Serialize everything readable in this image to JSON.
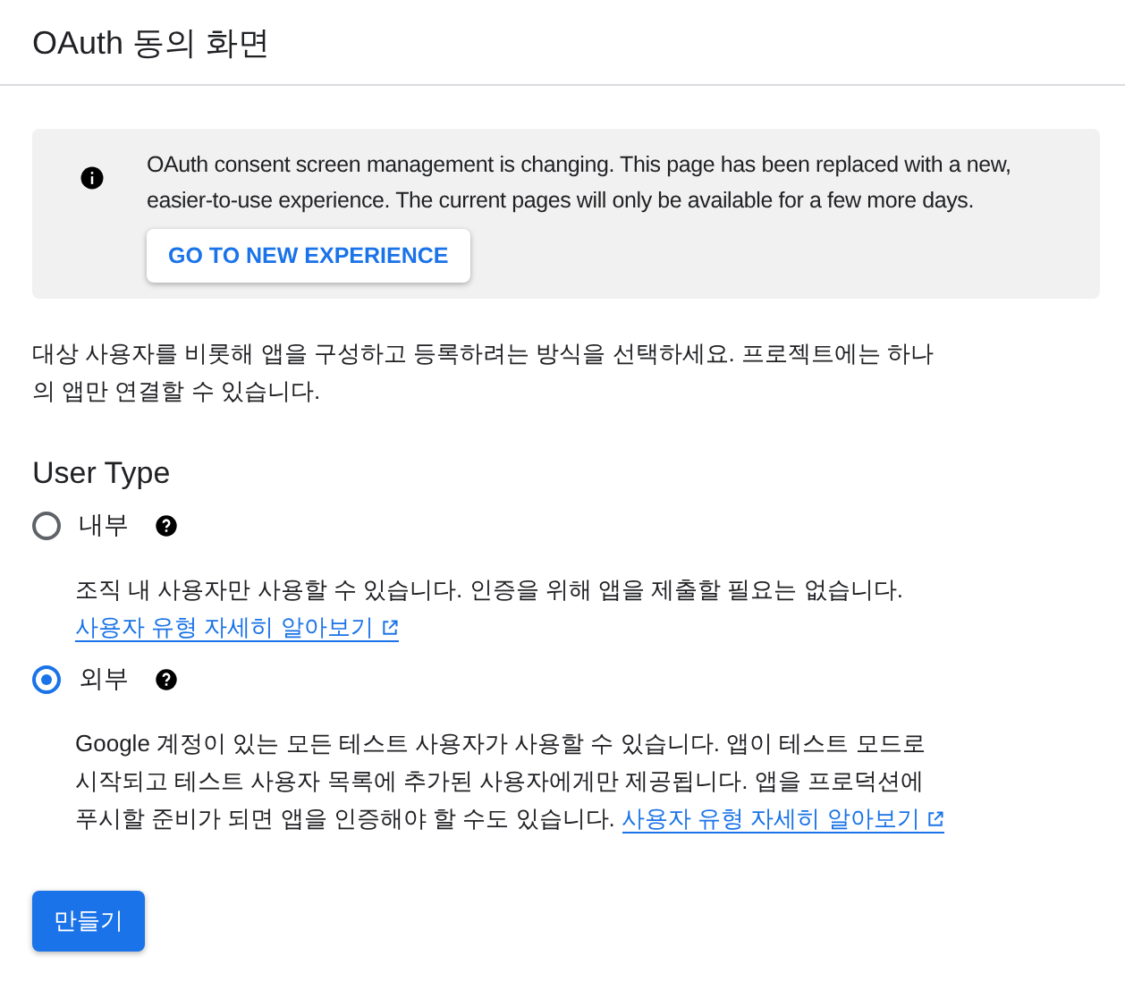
{
  "header": {
    "title": "OAuth 동의 화면"
  },
  "notice": {
    "text": "OAuth consent screen management is changing. This page has been replaced with a new, easier-to-use experience. The current pages will only be available for a few more days.",
    "button": "GO TO NEW EXPERIENCE"
  },
  "intro": "대상 사용자를 비롯해 앱을 구성하고 등록하려는 방식을 선택하세요. 프로젝트에는 하나의 앱만 연결할 수 있습니다.",
  "user_type": {
    "heading": "User Type",
    "options": [
      {
        "label": "내부",
        "selected": false,
        "description": "조직 내 사용자만 사용할 수 있습니다. 인증을 위해 앱을 제출할 필요는 없습니다.",
        "link": "사용자 유형 자세히 알아보기"
      },
      {
        "label": "외부",
        "selected": true,
        "description": "Google 계정이 있는 모든 테스트 사용자가 사용할 수 있습니다. 앱이 테스트 모드로 시작되고 테스트 사용자 목록에 추가된 사용자에게만 제공됩니다. 앱을 프로덕션에 푸시할 준비가 되면 앱을 인증해야 할 수도 있습니다.",
        "link": "사용자 유형 자세히 알아보기"
      }
    ]
  },
  "buttons": [
    {
      "label": "만들기"
    }
  ]
}
